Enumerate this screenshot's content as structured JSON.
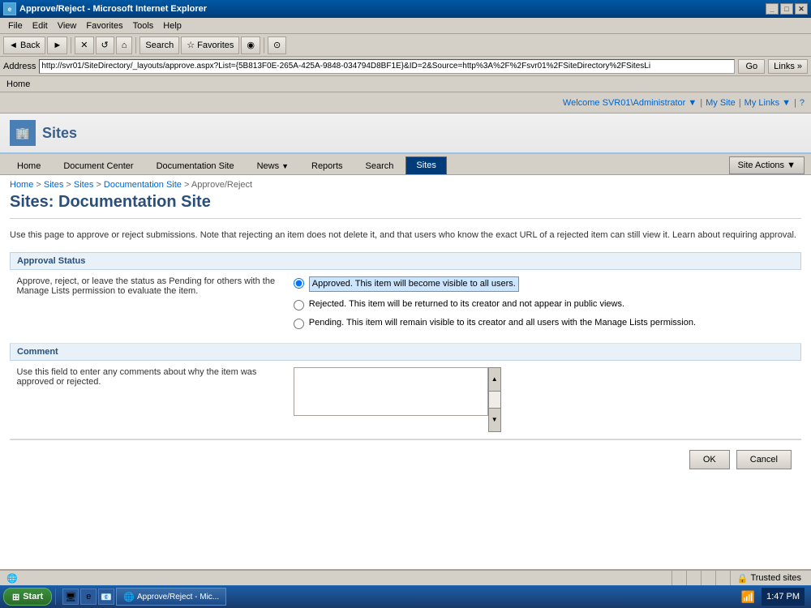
{
  "window": {
    "title": "Approve/Reject - Microsoft Internet Explorer",
    "icon": "IE"
  },
  "menu": {
    "items": [
      "File",
      "Edit",
      "View",
      "Favorites",
      "Tools",
      "Help"
    ]
  },
  "toolbar": {
    "back_label": "◄ Back",
    "forward_label": "►",
    "stop_label": "✕",
    "refresh_label": "↺",
    "home_label": "⌂",
    "search_label": "Search",
    "favorites_label": "☆ Favorites",
    "media_label": "◉",
    "history_label": "⊙"
  },
  "address_bar": {
    "label": "Address",
    "url": "http://svr01/SiteDirectory/_layouts/approve.aspx?List={5B813F0E-265A-425A-9848-034794D8BF1E}&ID=2&Source=http%3A%2F%2Fsvr01%2FSiteDirectory%2FSitesLi",
    "go_label": "Go",
    "links_label": "Links »"
  },
  "home_bar": {
    "label": "Home"
  },
  "sharepoint": {
    "top_bar": {
      "welcome": "Welcome SVR01\\Administrator ▼",
      "my_site": "My Site",
      "my_links": "My Links ▼",
      "help_icon": "?"
    },
    "header": {
      "icon": "🏢",
      "title": "Sites"
    },
    "nav": {
      "tabs": [
        {
          "label": "Home",
          "active": false
        },
        {
          "label": "Document Center",
          "active": false
        },
        {
          "label": "Documentation Site",
          "active": false
        },
        {
          "label": "News",
          "active": false,
          "has_dropdown": true
        },
        {
          "label": "Reports",
          "active": false
        },
        {
          "label": "Search",
          "active": false
        },
        {
          "label": "Sites",
          "active": true
        }
      ],
      "site_actions": "Site Actions ▼"
    },
    "breadcrumb": {
      "items": [
        "Home",
        "Sites",
        "Sites",
        "Documentation Site",
        "Approve/Reject"
      ]
    },
    "page_title": "Sites: Documentation Site",
    "description": "Use this page to approve or reject submissions. Note that rejecting an item does not delete it, and that users who know the exact URL of a rejected item can still view it. Learn about requiring approval.",
    "approval_section": {
      "header": "Approval Status",
      "description": "Approve, reject, or leave the status as Pending for others with the Manage Lists permission to evaluate the item.",
      "options": [
        {
          "id": "approved",
          "label": "Approved. This item will become visible to all users.",
          "selected": true
        },
        {
          "id": "rejected",
          "label": "Rejected. This item will be returned to its creator and not appear in public views.",
          "selected": false
        },
        {
          "id": "pending",
          "label": "Pending. This item will remain visible to its creator and all users with the Manage Lists permission.",
          "selected": false
        }
      ]
    },
    "comment_section": {
      "header": "Comment",
      "description": "Use this field to enter any comments about why the item was approved or rejected.",
      "placeholder": ""
    },
    "buttons": {
      "ok": "OK",
      "cancel": "Cancel"
    }
  },
  "status_bar": {
    "zone": "Trusted sites",
    "progress": ""
  },
  "taskbar": {
    "start_label": "Start",
    "items": [
      {
        "label": "Approve/Reject - Mic..."
      }
    ],
    "clock": "1:47 PM"
  }
}
